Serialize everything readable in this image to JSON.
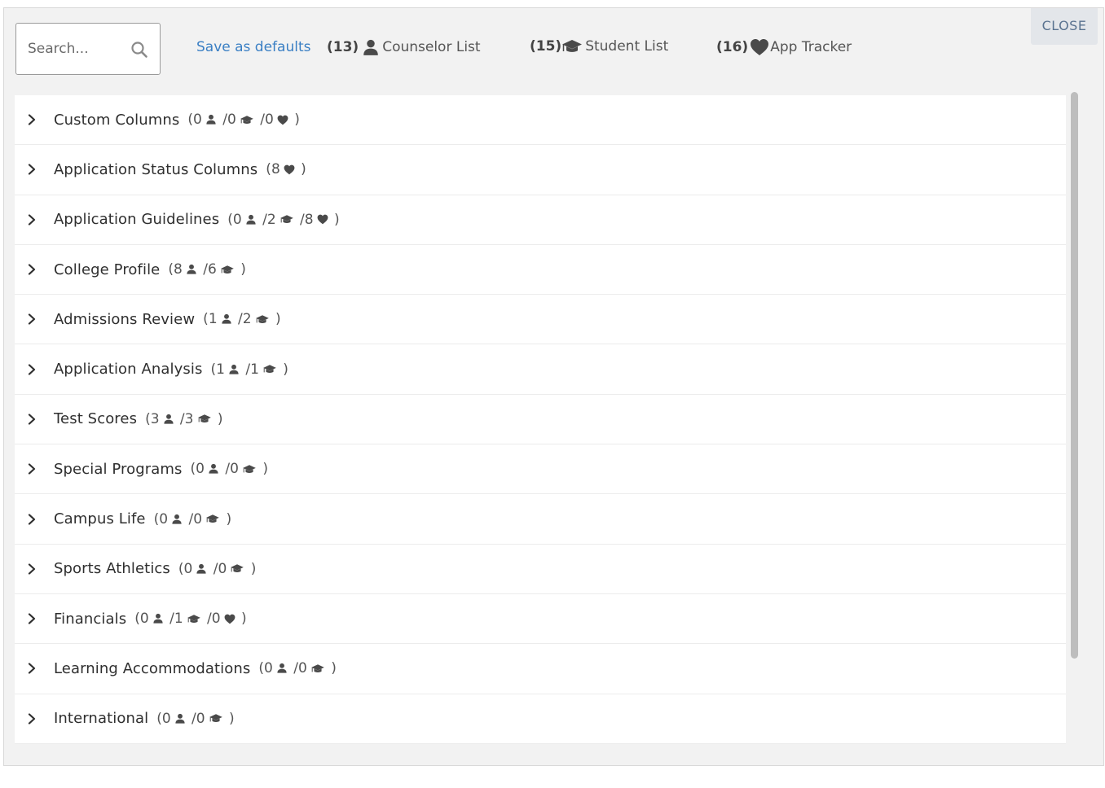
{
  "search": {
    "placeholder": "Search..."
  },
  "toolbar": {
    "save_label": "Save as defaults",
    "lists": [
      {
        "count": "(13)",
        "icon": "person-icon",
        "label": "Counselor List"
      },
      {
        "count": "(15)",
        "icon": "graduation-cap-icon",
        "label": "Student List"
      },
      {
        "count": "(16)",
        "icon": "heart-icon",
        "label": "App Tracker"
      }
    ],
    "close_label": "CLOSE"
  },
  "sections": [
    {
      "title": "Custom Columns",
      "counts": [
        {
          "n": "0",
          "icon": "person"
        },
        {
          "n": "0",
          "icon": "cap"
        },
        {
          "n": "0",
          "icon": "heart"
        }
      ]
    },
    {
      "title": "Application Status Columns",
      "counts": [
        {
          "n": "8",
          "icon": "heart"
        }
      ]
    },
    {
      "title": "Application Guidelines",
      "counts": [
        {
          "n": "0",
          "icon": "person"
        },
        {
          "n": "2",
          "icon": "cap"
        },
        {
          "n": "8",
          "icon": "heart"
        }
      ]
    },
    {
      "title": "College Profile",
      "counts": [
        {
          "n": "8",
          "icon": "person"
        },
        {
          "n": "6",
          "icon": "cap"
        }
      ]
    },
    {
      "title": "Admissions Review",
      "counts": [
        {
          "n": "1",
          "icon": "person"
        },
        {
          "n": "2",
          "icon": "cap"
        }
      ]
    },
    {
      "title": "Application Analysis",
      "counts": [
        {
          "n": "1",
          "icon": "person"
        },
        {
          "n": "1",
          "icon": "cap"
        }
      ]
    },
    {
      "title": "Test Scores",
      "counts": [
        {
          "n": "3",
          "icon": "person"
        },
        {
          "n": "3",
          "icon": "cap"
        }
      ]
    },
    {
      "title": "Special Programs",
      "counts": [
        {
          "n": "0",
          "icon": "person"
        },
        {
          "n": "0",
          "icon": "cap"
        }
      ]
    },
    {
      "title": "Campus Life",
      "counts": [
        {
          "n": "0",
          "icon": "person"
        },
        {
          "n": "0",
          "icon": "cap"
        }
      ]
    },
    {
      "title": "Sports Athletics",
      "counts": [
        {
          "n": "0",
          "icon": "person"
        },
        {
          "n": "0",
          "icon": "cap"
        }
      ]
    },
    {
      "title": "Financials",
      "counts": [
        {
          "n": "0",
          "icon": "person"
        },
        {
          "n": "1",
          "icon": "cap"
        },
        {
          "n": "0",
          "icon": "heart"
        }
      ]
    },
    {
      "title": "Learning Accommodations",
      "counts": [
        {
          "n": "0",
          "icon": "person"
        },
        {
          "n": "0",
          "icon": "cap"
        }
      ]
    },
    {
      "title": "International",
      "counts": [
        {
          "n": "0",
          "icon": "person"
        },
        {
          "n": "0",
          "icon": "cap"
        }
      ]
    }
  ],
  "colors": {
    "link": "#3a7fc4",
    "close_bg": "#e3e6ea",
    "close_text": "#5a7390",
    "icon": "#4a4a4a"
  }
}
